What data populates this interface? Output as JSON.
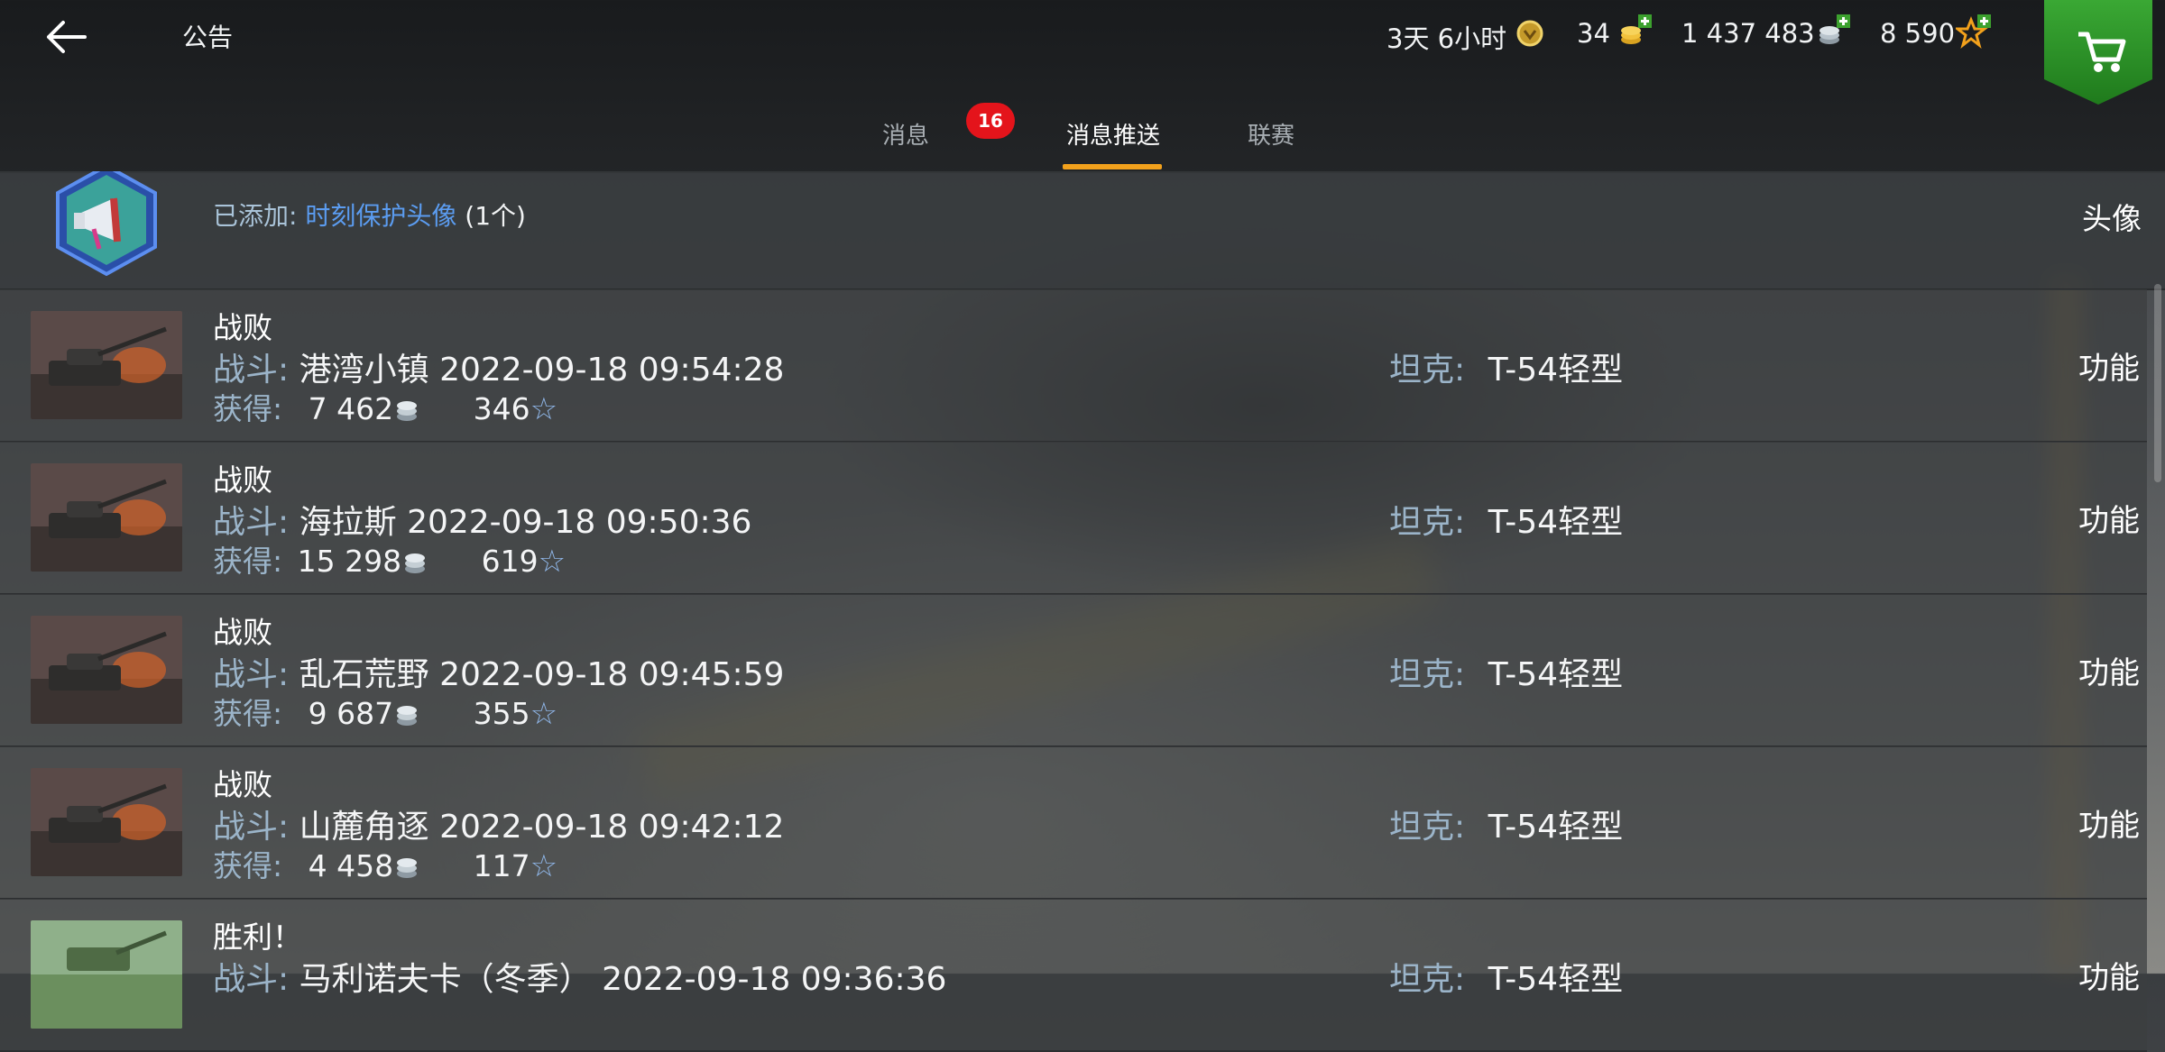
{
  "header": {
    "title": "公告",
    "premium_time": "3天 6小时",
    "gold": "34",
    "credits": "1 437 483",
    "free_xp": "8 590"
  },
  "tabs": [
    {
      "label": "消息",
      "badge": "16"
    },
    {
      "label": "消息推送",
      "active": true
    },
    {
      "label": "联赛"
    }
  ],
  "banner": {
    "prefix": "已添加:",
    "link": "时刻保护头像",
    "count": "(1个)",
    "action": "头像"
  },
  "labels": {
    "battle": "战斗:",
    "earned": "获得:",
    "tank": "坦克:",
    "action": "功能"
  },
  "rows": [
    {
      "result": "战败",
      "map": "港湾小镇",
      "datetime": "2022-09-18 09:54:28",
      "credits": "7 462",
      "xp": "346",
      "tank": "T-54轻型"
    },
    {
      "result": "战败",
      "map": "海拉斯",
      "datetime": "2022-09-18 09:50:36",
      "credits": "15 298",
      "xp": "619",
      "tank": "T-54轻型"
    },
    {
      "result": "战败",
      "map": "乱石荒野",
      "datetime": "2022-09-18 09:45:59",
      "credits": "9 687",
      "xp": "355",
      "tank": "T-54轻型"
    },
    {
      "result": "战败",
      "map": "山麓角逐",
      "datetime": "2022-09-18 09:42:12",
      "credits": "4 458",
      "xp": "117",
      "tank": "T-54轻型"
    },
    {
      "result": "胜利！",
      "map": "马利诺夫卡（冬季）",
      "datetime": "2022-09-18 09:36:36",
      "credits": "",
      "xp": "",
      "tank": "T-54轻型"
    }
  ],
  "colors": {
    "accent": "#f2a11c",
    "badge": "#e4141b",
    "link": "#5b9cf0",
    "label": "#9bb4c9",
    "shop": "#2f9a2a"
  }
}
